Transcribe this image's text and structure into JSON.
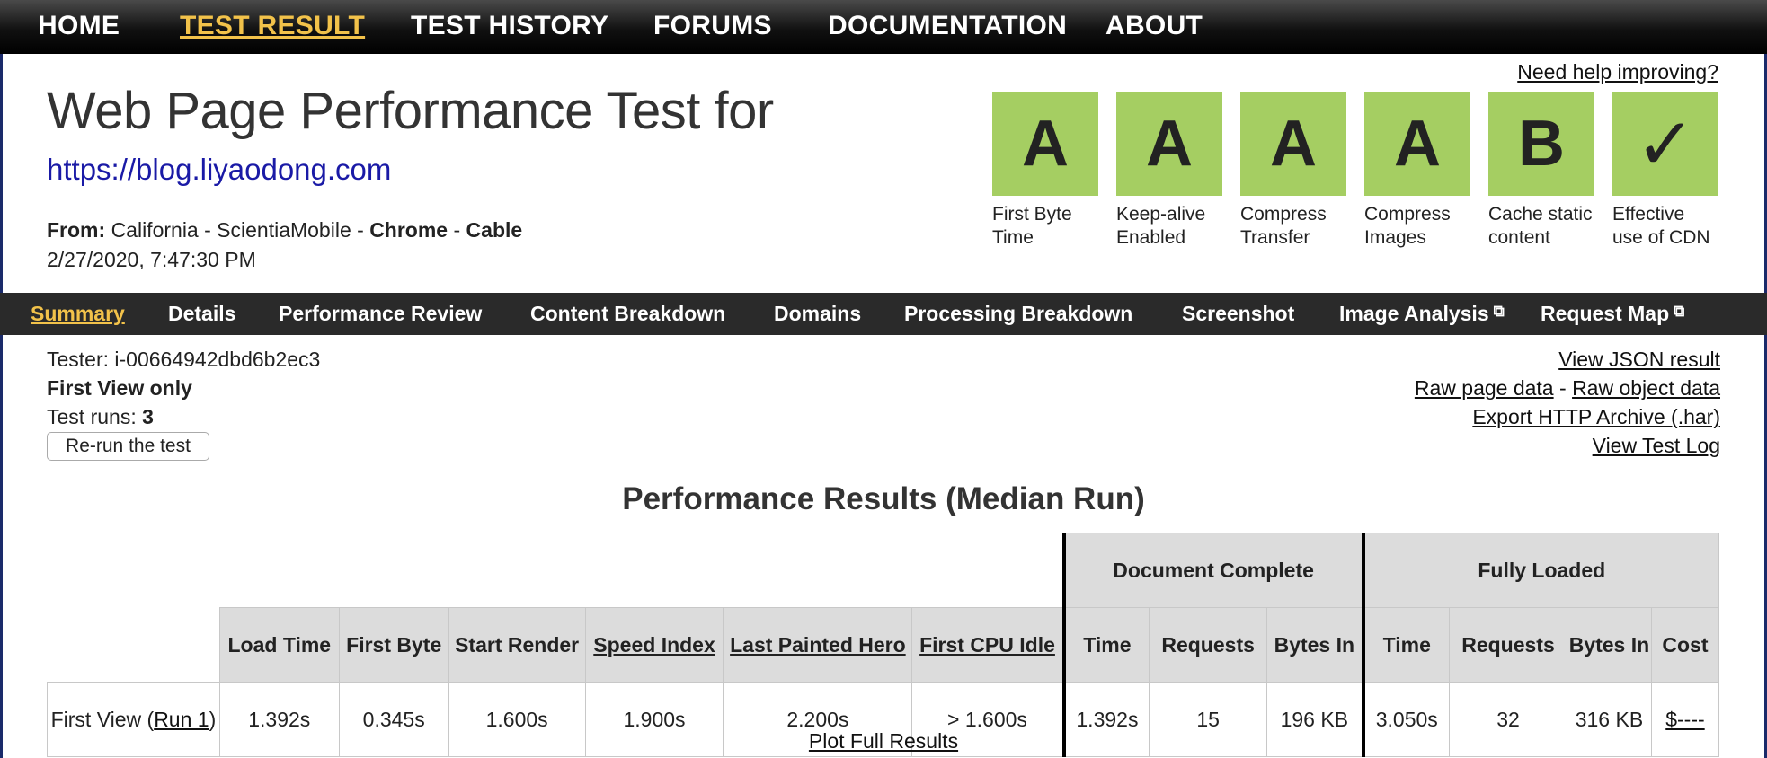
{
  "topnav": {
    "home": "HOME",
    "test_result": "TEST RESULT",
    "test_history": "TEST HISTORY",
    "forums": "FORUMS",
    "documentation": "DOCUMENTATION",
    "about": "ABOUT"
  },
  "header": {
    "title": "Web Page Performance Test for",
    "url": "https://blog.liyaodong.com",
    "from_label": "From:",
    "from_location": "California - ScientiaMobile -",
    "browser": "Chrome",
    "separator": "-",
    "connection": "Cable",
    "datetime": "2/27/2020, 7:47:30 PM",
    "help_link": "Need help improving?"
  },
  "grades": [
    {
      "grade": "A",
      "label": "First Byte Time"
    },
    {
      "grade": "A",
      "label": "Keep-alive Enabled"
    },
    {
      "grade": "A",
      "label": "Compress Transfer"
    },
    {
      "grade": "A",
      "label": "Compress Images"
    },
    {
      "grade": "B",
      "label": "Cache static content"
    },
    {
      "grade": "✓",
      "label": "Effective use of CDN"
    }
  ],
  "colors": {
    "grade_green": "#a5ce62",
    "accent_yellow": "#f2c24a",
    "subnav_bg": "#2a2a2a"
  },
  "subnav": {
    "summary": "Summary",
    "details": "Details",
    "performance_review": "Performance Review",
    "content_breakdown": "Content Breakdown",
    "domains": "Domains",
    "processing_breakdown": "Processing Breakdown",
    "screenshot": "Screenshot",
    "image_analysis": "Image Analysis",
    "request_map": "Request Map",
    "external_icon": "external-link-icon"
  },
  "test_info": {
    "tester": "Tester: i-00664942dbd6b2ec3",
    "view_mode": "First View only",
    "runs_label": "Test runs:",
    "runs_value": "3",
    "rerun_button": "Re-run the test"
  },
  "result_links": {
    "json": "View JSON result",
    "raw_page": "Raw page data",
    "dash": "-",
    "raw_object": "Raw object data",
    "har": "Export HTTP Archive (.har)",
    "log": "View Test Log"
  },
  "results": {
    "title": "Performance Results (Median Run)",
    "group_doc_complete": "Document Complete",
    "group_fully_loaded": "Fully Loaded",
    "columns": {
      "load_time": "Load Time",
      "first_byte": "First Byte",
      "start_render": "Start Render",
      "speed_index": "Speed Index",
      "last_painted_hero": "Last Painted Hero",
      "first_cpu_idle": "First CPU Idle",
      "doc_time": "Time",
      "doc_requests": "Requests",
      "doc_bytes": "Bytes In",
      "full_time": "Time",
      "full_requests": "Requests",
      "full_bytes": "Bytes In",
      "cost": "Cost"
    },
    "row": {
      "label_prefix": "First View (",
      "run_link": "Run 1",
      "label_suffix": ")",
      "load_time": "1.392s",
      "first_byte": "0.345s",
      "start_render": "1.600s",
      "speed_index": "1.900s",
      "last_painted_hero": "2.200s",
      "first_cpu_idle": "> 1.600s",
      "doc_time": "1.392s",
      "doc_requests": "15",
      "doc_bytes": "196 KB",
      "full_time": "3.050s",
      "full_requests": "32",
      "full_bytes": "316 KB",
      "cost": "$----"
    },
    "plot_link": "Plot Full Results"
  }
}
